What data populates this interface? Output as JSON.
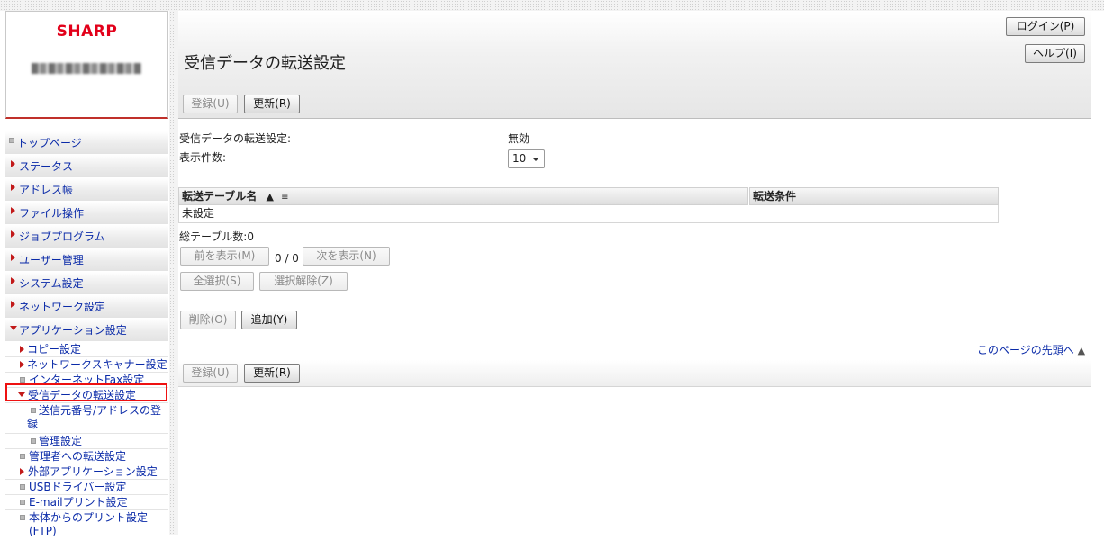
{
  "brand": {
    "logo_text": "SHARP"
  },
  "sidebar": {
    "items": [
      {
        "label": "トップページ",
        "marker": "square"
      },
      {
        "label": "ステータス",
        "marker": "arrow-right"
      },
      {
        "label": "アドレス帳",
        "marker": "arrow-right"
      },
      {
        "label": "ファイル操作",
        "marker": "arrow-right"
      },
      {
        "label": "ジョブプログラム",
        "marker": "arrow-right"
      },
      {
        "label": "ユーザー管理",
        "marker": "arrow-right"
      },
      {
        "label": "システム設定",
        "marker": "arrow-right"
      },
      {
        "label": "ネットワーク設定",
        "marker": "arrow-right"
      },
      {
        "label": "アプリケーション設定",
        "marker": "arrow-down"
      }
    ],
    "sub_items": [
      {
        "label": "コピー設定",
        "marker": "arrow-right"
      },
      {
        "label": "ネットワークスキャナー設定",
        "marker": "arrow-right"
      },
      {
        "label": "インターネットFax設定",
        "marker": "square"
      },
      {
        "label": "受信データの転送設定",
        "marker": "arrow-down",
        "selected": true
      },
      {
        "label": "送信元番号/アドレスの登",
        "label2": "録",
        "marker": "square"
      },
      {
        "label": "管理設定",
        "marker": "square"
      },
      {
        "label": "管理者への転送設定",
        "marker": "square"
      },
      {
        "label": "外部アプリケーション設定",
        "marker": "arrow-right"
      },
      {
        "label": "USBドライバー設定",
        "marker": "square"
      },
      {
        "label": "E-mailプリント設定",
        "marker": "square"
      },
      {
        "label": "本体からのプリント設定",
        "label2": "(FTP)",
        "marker": "square"
      }
    ]
  },
  "header": {
    "login_button": "ログイン(P)",
    "help_button": "ヘルプ(I)",
    "title": "受信データの転送設定",
    "register_button": "登録(U)",
    "update_button": "更新(R)"
  },
  "settings": {
    "forward_label": "受信データの転送設定:",
    "forward_value": "無効",
    "display_count_label": "表示件数:",
    "display_count_value": "10"
  },
  "table": {
    "columns": [
      "転送テーブル名",
      "転送条件"
    ],
    "sort_asc_glyph": "▲",
    "filter_glyph": "≡",
    "rows": [
      [
        "未設定",
        ""
      ]
    ]
  },
  "pagination": {
    "total_label": "総テーブル数:0",
    "prev_button": "前を表示(M)",
    "page_indicator": "0 / 0",
    "next_button": "次を表示(N)",
    "select_all_button": "全選択(S)",
    "deselect_button": "選択解除(Z)"
  },
  "actions": {
    "delete_button": "削除(O)",
    "add_button": "追加(Y)"
  },
  "footer": {
    "top_link": "このページの先頭へ",
    "top_link_glyph": "▲",
    "register_button": "登録(U)",
    "update_button": "更新(R)"
  },
  "colors": {
    "brand_red": "#e2001a",
    "link_blue": "#0a2aa8",
    "highlight_red": "#ee1111"
  }
}
